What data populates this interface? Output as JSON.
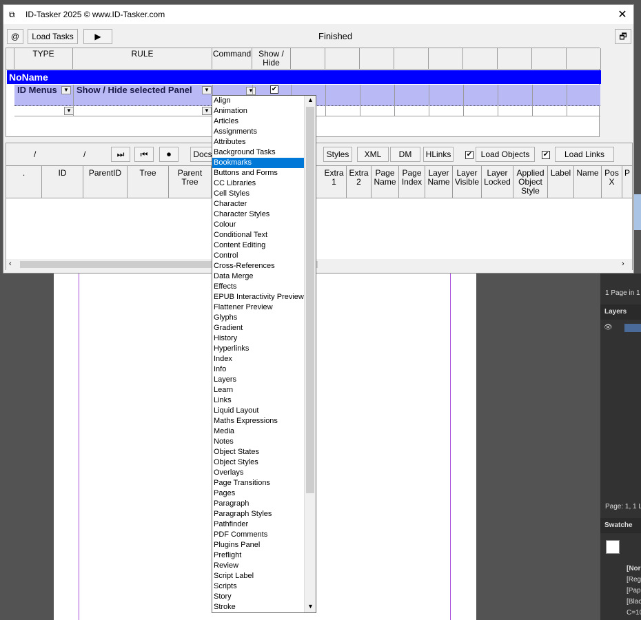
{
  "window": {
    "title": "ID-Tasker 2025   © www.ID-Tasker.com",
    "close": "✕"
  },
  "toolbar": {
    "at_label": "@",
    "load_tasks": "Load Tasks",
    "play": "▶",
    "status": "Finished",
    "restore": "🗗"
  },
  "grid": {
    "headers": [
      "TYPE",
      "RULE",
      "Command",
      "Show / Hide"
    ],
    "group_name": "NoName",
    "row1": {
      "type": "ID Menus",
      "rule": "Show / Hide selected Panel",
      "show_hide_checked": "✔"
    }
  },
  "lower_toolbar": {
    "slash1": "/",
    "slash2": "/",
    "btn_last": "⏭",
    "btn_first": "⏮",
    "btn_record": "⏺",
    "docs": "Docs",
    "styles": "Styles",
    "xml": "XML",
    "dm": "DM",
    "hlinks": "HLinks",
    "load_objects": "Load Objects",
    "load_links": "Load Links",
    "check": "✔"
  },
  "columns": [
    ".",
    "ID",
    "ParentID",
    "Tree",
    "Parent Tree",
    "Extra 1",
    "Extra 2",
    "Page Name",
    "Page Index",
    "Layer Name",
    "Layer Visible",
    "Layer Locked",
    "Applied Object Style",
    "Label",
    "Name",
    "Pos X",
    "P"
  ],
  "dropdown": {
    "selected": "Bookmarks",
    "items": [
      "Align",
      "Animation",
      "Articles",
      "Assignments",
      "Attributes",
      "Background Tasks",
      "Bookmarks",
      "Buttons and Forms",
      "CC Libraries",
      "Cell Styles",
      "Character",
      "Character Styles",
      "Colour",
      "Conditional Text",
      "Content Editing",
      "Control",
      "Cross-References",
      "Data Merge",
      "Effects",
      "EPUB Interactivity Preview",
      "Flattener Preview",
      "Glyphs",
      "Gradient",
      "History",
      "Hyperlinks",
      "Index",
      "Info",
      "Layers",
      "Learn",
      "Links",
      "Liquid Layout",
      "Maths Expressions",
      "Media",
      "Notes",
      "Object States",
      "Object Styles",
      "Overlays",
      "Page Transitions",
      "Pages",
      "Paragraph",
      "Paragraph Styles",
      "Pathfinder",
      "PDF Comments",
      "Plugins Panel",
      "Preflight",
      "Review",
      "Script Label",
      "Scripts",
      "Story",
      "Stroke"
    ]
  },
  "background_app": {
    "pages_info": "1 Page in 1",
    "layers_label": "Layers",
    "page_status": "Page: 1, 1 L",
    "swatches_label": "Swatche",
    "swatches": [
      "[Nor",
      "[Reg",
      "[Pap",
      "[Blac",
      "C=10"
    ],
    "colors": {
      "accent": "#0078d7",
      "group_row": "#0000ff",
      "row_fill": "#b9b9f5",
      "guide": "#a64cd8"
    }
  }
}
